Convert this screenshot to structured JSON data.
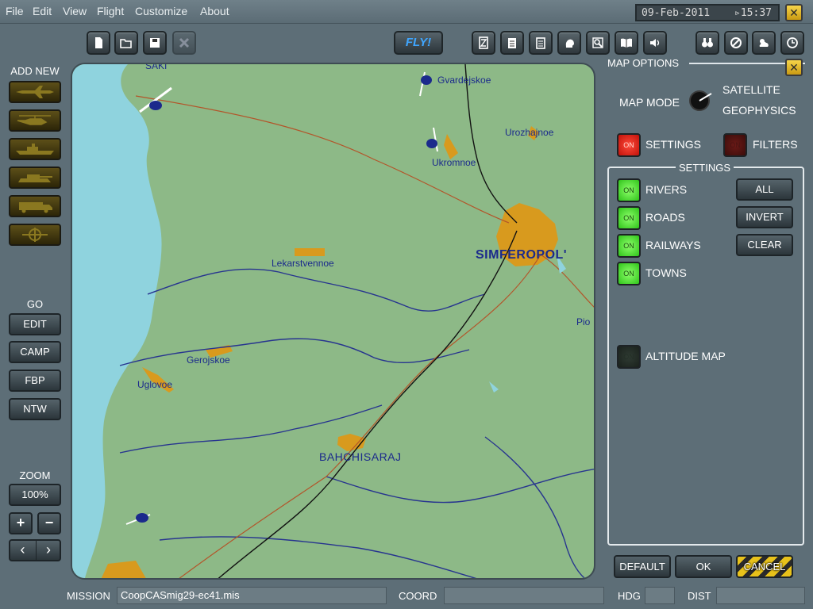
{
  "menu": [
    "File",
    "Edit",
    "View",
    "Flight",
    "Customize",
    "About"
  ],
  "datetime": {
    "date": "09-Feb-2011",
    "time": "▹15:37"
  },
  "close_symbol": "✕",
  "toolbar": {
    "fly_label": "FLY!"
  },
  "left_panel": {
    "add_new_label": "ADD NEW",
    "go_label": "GO",
    "go_buttons": [
      "EDIT",
      "CAMP",
      "FBP",
      "NTW"
    ],
    "zoom_label": "ZOOM",
    "zoom_value": "100%",
    "zoom_in": "+",
    "zoom_out": "−",
    "prev": "‹",
    "next": "›"
  },
  "map": {
    "towns": [
      "SAKI",
      "Gvardejskoe",
      "Urozhajnoe",
      "Ukromnoe",
      "Lekarstvennoe",
      "Gerojskoe",
      "Uglovoe",
      "BAHCHISARAJ",
      "Pio"
    ],
    "city": "SIMFEROPOL'"
  },
  "map_options": {
    "title": "MAP OPTIONS",
    "map_mode_label": "MAP MODE",
    "mode_satellite": "SATELLITE",
    "mode_geophysics": "GEOPHYSICS",
    "led_on": "ON",
    "settings_toggle": "SETTINGS",
    "filters_toggle": "FILTERS",
    "settings_section_title": "SETTINGS",
    "layers": [
      "RIVERS",
      "ROADS",
      "RAILWAYS",
      "TOWNS"
    ],
    "altitude_map": "ALTITUDE MAP",
    "all_button": "ALL",
    "invert_button": "INVERT",
    "clear_button": "CLEAR"
  },
  "dialog_buttons": {
    "default": "DEFAULT",
    "ok": "OK",
    "cancel": "CANCEL"
  },
  "status": {
    "mission_label": "MISSION",
    "mission_value": "CoopCASmig29-ec41.mis",
    "coord_label": "COORD",
    "coord_value": "",
    "hdg_label": "HDG",
    "hdg_value": "",
    "dist_label": "DIST",
    "dist_value": ""
  },
  "colors": {
    "map_land": "#8db987",
    "sea": "#8fd3de",
    "town_fill": "#d89a1e",
    "river": "#27348f",
    "road": "#b3552a",
    "rail": "#111111",
    "led_green": "#3fd22a",
    "led_red": "#e0221a",
    "fly_text": "#3fa6ff"
  }
}
